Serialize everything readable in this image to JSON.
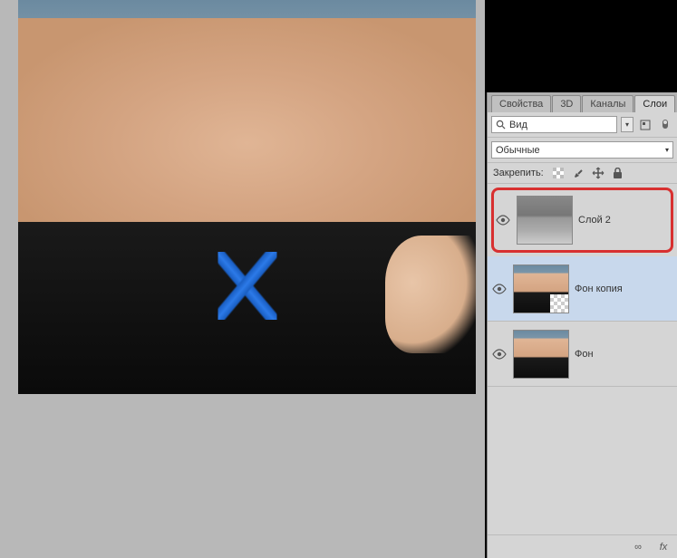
{
  "tabs": {
    "properties": "Свойства",
    "threed": "3D",
    "channels": "Каналы",
    "layers": "Слои"
  },
  "search": {
    "label": "Вид"
  },
  "blend": {
    "mode": "Обычные"
  },
  "lock": {
    "label": "Закрепить:"
  },
  "layers": [
    {
      "name": "Слой 2",
      "highlighted": true,
      "selected": false,
      "thumb": "gray"
    },
    {
      "name": "Фон копия",
      "highlighted": false,
      "selected": true,
      "thumb": "photo-trans"
    },
    {
      "name": "Фон",
      "highlighted": false,
      "selected": false,
      "thumb": "photo"
    }
  ],
  "icons": {
    "search": "search",
    "filter": "filter",
    "link": "∞",
    "fx": "fx"
  }
}
